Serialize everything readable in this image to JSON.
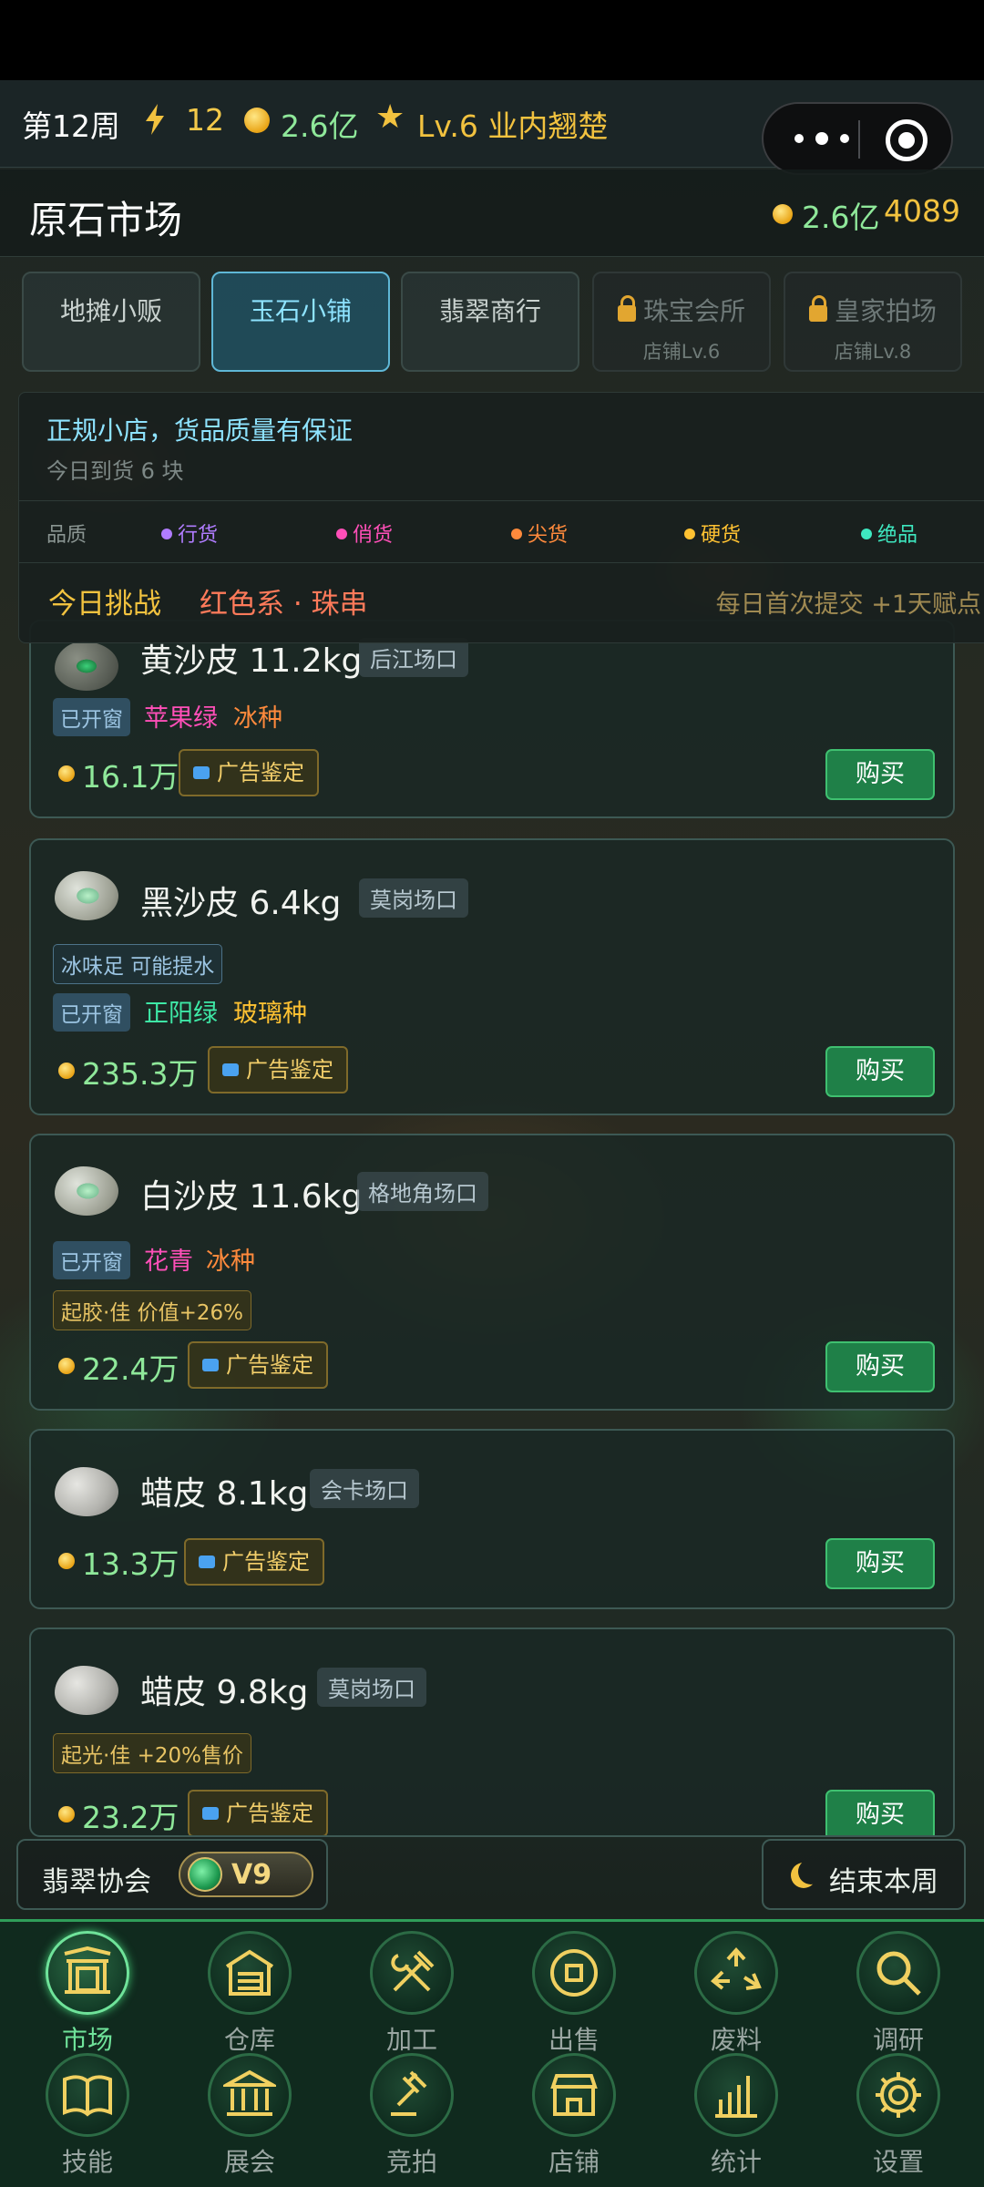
{
  "hud": {
    "week": "第12周",
    "energy": "12",
    "money": "2.6亿",
    "level": "Lv.6 业内翘楚"
  },
  "header": {
    "title": "原石市场",
    "money": "2.6亿",
    "points": "4089"
  },
  "tabs": [
    {
      "label": "地摊小贩",
      "sub": "",
      "locked": false,
      "active": false
    },
    {
      "label": "玉石小铺",
      "sub": "",
      "locked": false,
      "active": true
    },
    {
      "label": "翡翠商行",
      "sub": "",
      "locked": false,
      "active": false
    },
    {
      "label": "珠宝会所",
      "sub": "店铺Lv.6",
      "locked": true,
      "active": false
    },
    {
      "label": "皇家拍场",
      "sub": "店铺Lv.8",
      "locked": true,
      "active": false
    }
  ],
  "shop_info": {
    "description": "正规小店，货品质量有保证",
    "arrival": "今日到货 6 块",
    "quality_label": "品质",
    "qualities": [
      {
        "name": "行货",
        "color": "#b07cff"
      },
      {
        "name": "俏货",
        "color": "#ff4fb8"
      },
      {
        "name": "尖货",
        "color": "#ff8a3c"
      },
      {
        "name": "硬货",
        "color": "#ffc232"
      },
      {
        "name": "绝品",
        "color": "#3ee8c0"
      }
    ],
    "challenge_prefix": "今日挑战",
    "challenge_target": "红色系 · 珠串",
    "challenge_bonus": "每日首次提交 +1天赋点"
  },
  "stones": [
    {
      "name": "黄沙皮 11.2kg",
      "origin": "后江场口",
      "window": "已开窗",
      "color_tag": "苹果绿",
      "kind_tag": "冰种",
      "price": "16.1万",
      "ad": "广告鉴定",
      "buy": "购买"
    },
    {
      "name": "黑沙皮 6.4kg",
      "origin": "莫岗场口",
      "note": "冰味足 可能提水",
      "window": "已开窗",
      "color_tag": "正阳绿",
      "kind_tag": "玻璃种",
      "price": "235.3万",
      "ad": "广告鉴定",
      "buy": "购买"
    },
    {
      "name": "白沙皮 11.6kg",
      "origin": "格地角场口",
      "window": "已开窗",
      "color_tag": "花青",
      "kind_tag": "冰种",
      "bonus": "起胶·佳 价值+26%",
      "price": "22.4万",
      "ad": "广告鉴定",
      "buy": "购买"
    },
    {
      "name": "蜡皮 8.1kg",
      "origin": "会卡场口",
      "price": "13.3万",
      "ad": "广告鉴定",
      "buy": "购买"
    },
    {
      "name": "蜡皮 9.8kg",
      "origin": "莫岗场口",
      "bonus": "起光·佳 +20%售价",
      "price": "23.2万",
      "ad": "广告鉴定",
      "buy": "购买"
    }
  ],
  "colors": {
    "color_tag": "#ff4fb8",
    "kind_tag": "#ff8a3c",
    "accent_green": "#3fc070",
    "gold": "#f2c23f"
  },
  "association": {
    "label": "翡翠协会",
    "vip": "V9"
  },
  "end_week": "结束本周",
  "nav": [
    {
      "label": "市场",
      "icon": "market-gate-icon"
    },
    {
      "label": "仓库",
      "icon": "warehouse-icon"
    },
    {
      "label": "加工",
      "icon": "hammer-wrench-icon"
    },
    {
      "label": "出售",
      "icon": "coin-trade-icon"
    },
    {
      "label": "废料",
      "icon": "recycle-icon"
    },
    {
      "label": "调研",
      "icon": "magnifier-icon"
    },
    {
      "label": "技能",
      "icon": "book-icon"
    },
    {
      "label": "展会",
      "icon": "museum-icon"
    },
    {
      "label": "竞拍",
      "icon": "gavel-icon"
    },
    {
      "label": "店铺",
      "icon": "shop-icon"
    },
    {
      "label": "统计",
      "icon": "bar-chart-icon"
    },
    {
      "label": "设置",
      "icon": "gear-icon"
    }
  ]
}
